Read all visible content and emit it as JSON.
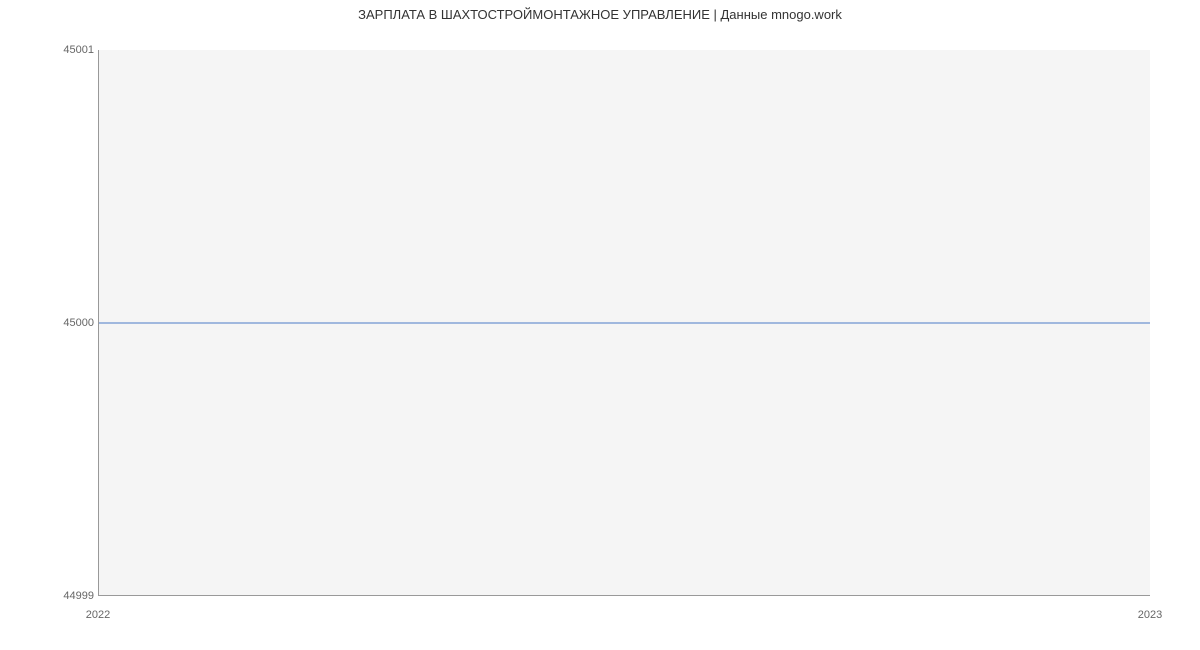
{
  "chart_data": {
    "type": "line",
    "title": "ЗАРПЛАТА В  ШАХТОСТРОЙМОНТАЖНОЕ УПРАВЛЕНИЕ | Данные mnogo.work",
    "xlabel": "",
    "ylabel": "",
    "x": [
      "2022",
      "2023"
    ],
    "series": [
      {
        "name": "salary",
        "values": [
          45000,
          45000
        ]
      }
    ],
    "ylim": [
      44999,
      45001
    ],
    "y_ticks": [
      44999,
      45000,
      45001
    ],
    "x_ticks": [
      "2022",
      "2023"
    ]
  },
  "labels": {
    "y_44999": "44999",
    "y_45000": "45000",
    "y_45001": "45001",
    "x_2022": "2022",
    "x_2023": "2023"
  }
}
